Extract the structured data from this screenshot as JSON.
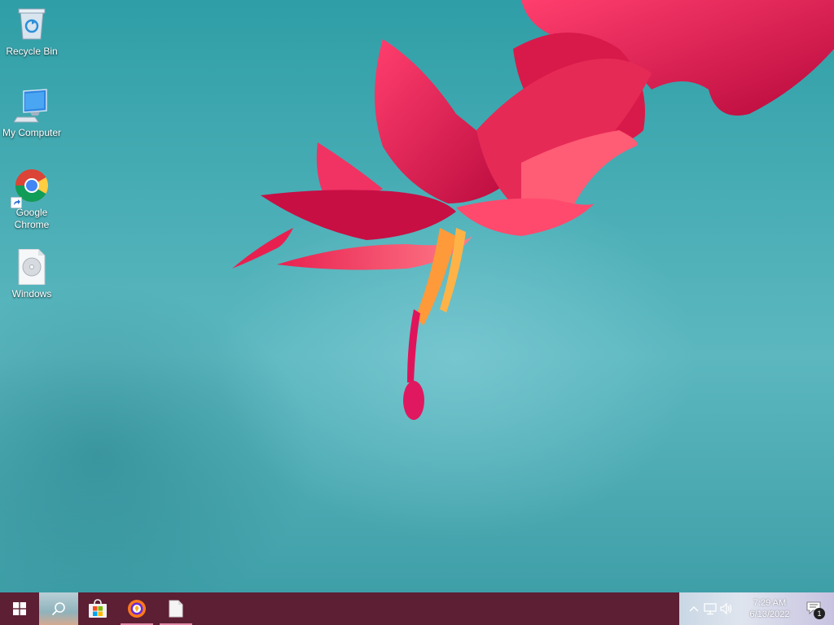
{
  "desktop": {
    "icons": [
      {
        "label": "Recycle Bin",
        "icon": "recycle-bin-icon"
      },
      {
        "label": "My Computer",
        "icon": "computer-icon"
      },
      {
        "label": "Google Chrome",
        "icon": "chrome-icon"
      },
      {
        "label": "Windows",
        "icon": "disc-image-file-icon"
      }
    ]
  },
  "taskbar": {
    "buttons": [
      {
        "name": "start",
        "icon": "windows-logo-icon"
      },
      {
        "name": "search",
        "icon": "search-icon"
      },
      {
        "name": "microsoft-store",
        "icon": "store-icon"
      },
      {
        "name": "browser-app",
        "icon": "browser-app-icon"
      },
      {
        "name": "file",
        "icon": "file-icon"
      }
    ],
    "tray": {
      "icons": [
        "chevron-up-icon",
        "network-icon",
        "volume-icon"
      ],
      "time": "7:29 AM",
      "date": "6/13/2022",
      "notification_count": "1"
    },
    "colors": {
      "taskbar": "#5c1f34",
      "accent": "#e58aa6"
    }
  }
}
